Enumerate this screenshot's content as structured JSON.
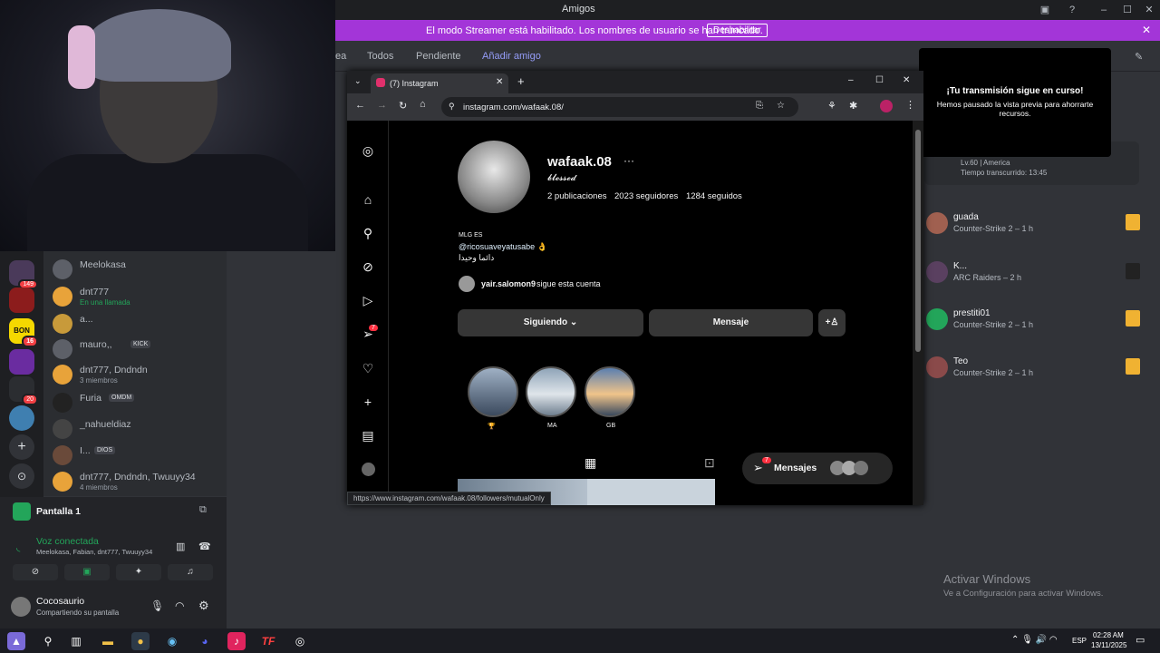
{
  "discord": {
    "title": "Amigos",
    "streamer_msg": "El modo Streamer está habilitado. Los nombres de usuario se han truncado.",
    "streamer_btn": "Deshabilitar",
    "tabs": [
      "ea",
      "Todos",
      "Pendiente",
      "Añadir amigo"
    ],
    "servers": [
      {
        "badge": "149"
      },
      {
        "badge": ""
      },
      {
        "label": "BON",
        "badge": "16"
      },
      {
        "badge": ""
      },
      {
        "badge": "20"
      },
      {
        "badge": ""
      }
    ],
    "dms": [
      {
        "name": "Meelokasa",
        "sub": "",
        "tag": ""
      },
      {
        "name": "dnt777",
        "sub": "En una llamada",
        "tag": ""
      },
      {
        "name": "a...",
        "sub": "",
        "tag": ""
      },
      {
        "name": "mauro,,",
        "sub": "",
        "tag": "KICK"
      },
      {
        "name": "dnt777, Dndndn",
        "sub": "3 miembros",
        "tag": ""
      },
      {
        "name": "Furia",
        "sub": "",
        "tag": "OMDM"
      },
      {
        "name": "_nahueldiaz",
        "sub": "",
        "tag": ""
      },
      {
        "name": "I...",
        "sub": "",
        "tag": "DIOS"
      },
      {
        "name": "dnt777, Dndndn, Twuuyy34",
        "sub": "4 miembros",
        "tag": ""
      }
    ],
    "screen_share": "Pantalla 1",
    "voice_status": "Voz conectada",
    "voice_members": "Meelokasa, Fabian, dnt777, Twuuyy34",
    "user_name": "Cocosaurio",
    "user_status": "Compartiendo su pantalla",
    "toast_title": "¡Tu transmisión sigue en curso!",
    "toast_body": "Hemos pausado la vista previa para ahorrarte recursos.",
    "activity_top": {
      "line1": "Lv.60 | America",
      "line2": "Tiempo transcurrido: 13:45"
    },
    "activity": [
      {
        "name": "guada",
        "game": "Counter-Strike 2 – 1 h",
        "avatar": "#a06050"
      },
      {
        "name": "K...",
        "game": "ARC Raiders – 2 h",
        "avatar": "#5a4060"
      },
      {
        "name": "prestiti01",
        "game": "Counter-Strike 2 – 1 h",
        "avatar": "#23a55a"
      },
      {
        "name": "Teo",
        "game": "Counter-Strike 2 – 1 h",
        "avatar": "#8a4a4a"
      }
    ],
    "windows_activate": "Activar Windows",
    "windows_activate_sub": "Ve a Configuración para activar Windows."
  },
  "browser": {
    "tab_title": "(7) Instagram",
    "url": "instagram.com/wafaak.08/",
    "status_url": "https://www.instagram.com/wafaak.08/followers/mutualOnly"
  },
  "instagram": {
    "username": "wafaak.08",
    "fullname": "𝓫𝓵𝓮𝓼𝓼𝓮𝓭",
    "posts": "2 publicaciones",
    "followers": "2023 seguidores",
    "following": "1284 seguidos",
    "bio_category": "MLG ES",
    "bio_mention": "@ricosuaveyatusabe 👌",
    "bio_text": "دائما وحيدا",
    "followed_by_user": "yair.salomon9",
    "followed_by_suffix": " sigue esta cuenta",
    "btn_following": "Siguiendo ⌄",
    "btn_message": "Mensaje",
    "highlights": [
      "🏆",
      "MA",
      "GB"
    ],
    "messages_label": "Mensajes",
    "messages_badge": "7",
    "notif_badge": "7"
  },
  "taskbar": {
    "lang": "ESP",
    "time": "02:28 AM",
    "date": "13/11/2025"
  },
  "colors": {
    "accent": "#a335d8",
    "discord_bg": "#313338",
    "ig_bg": "#000000",
    "online": "#23a55a"
  }
}
